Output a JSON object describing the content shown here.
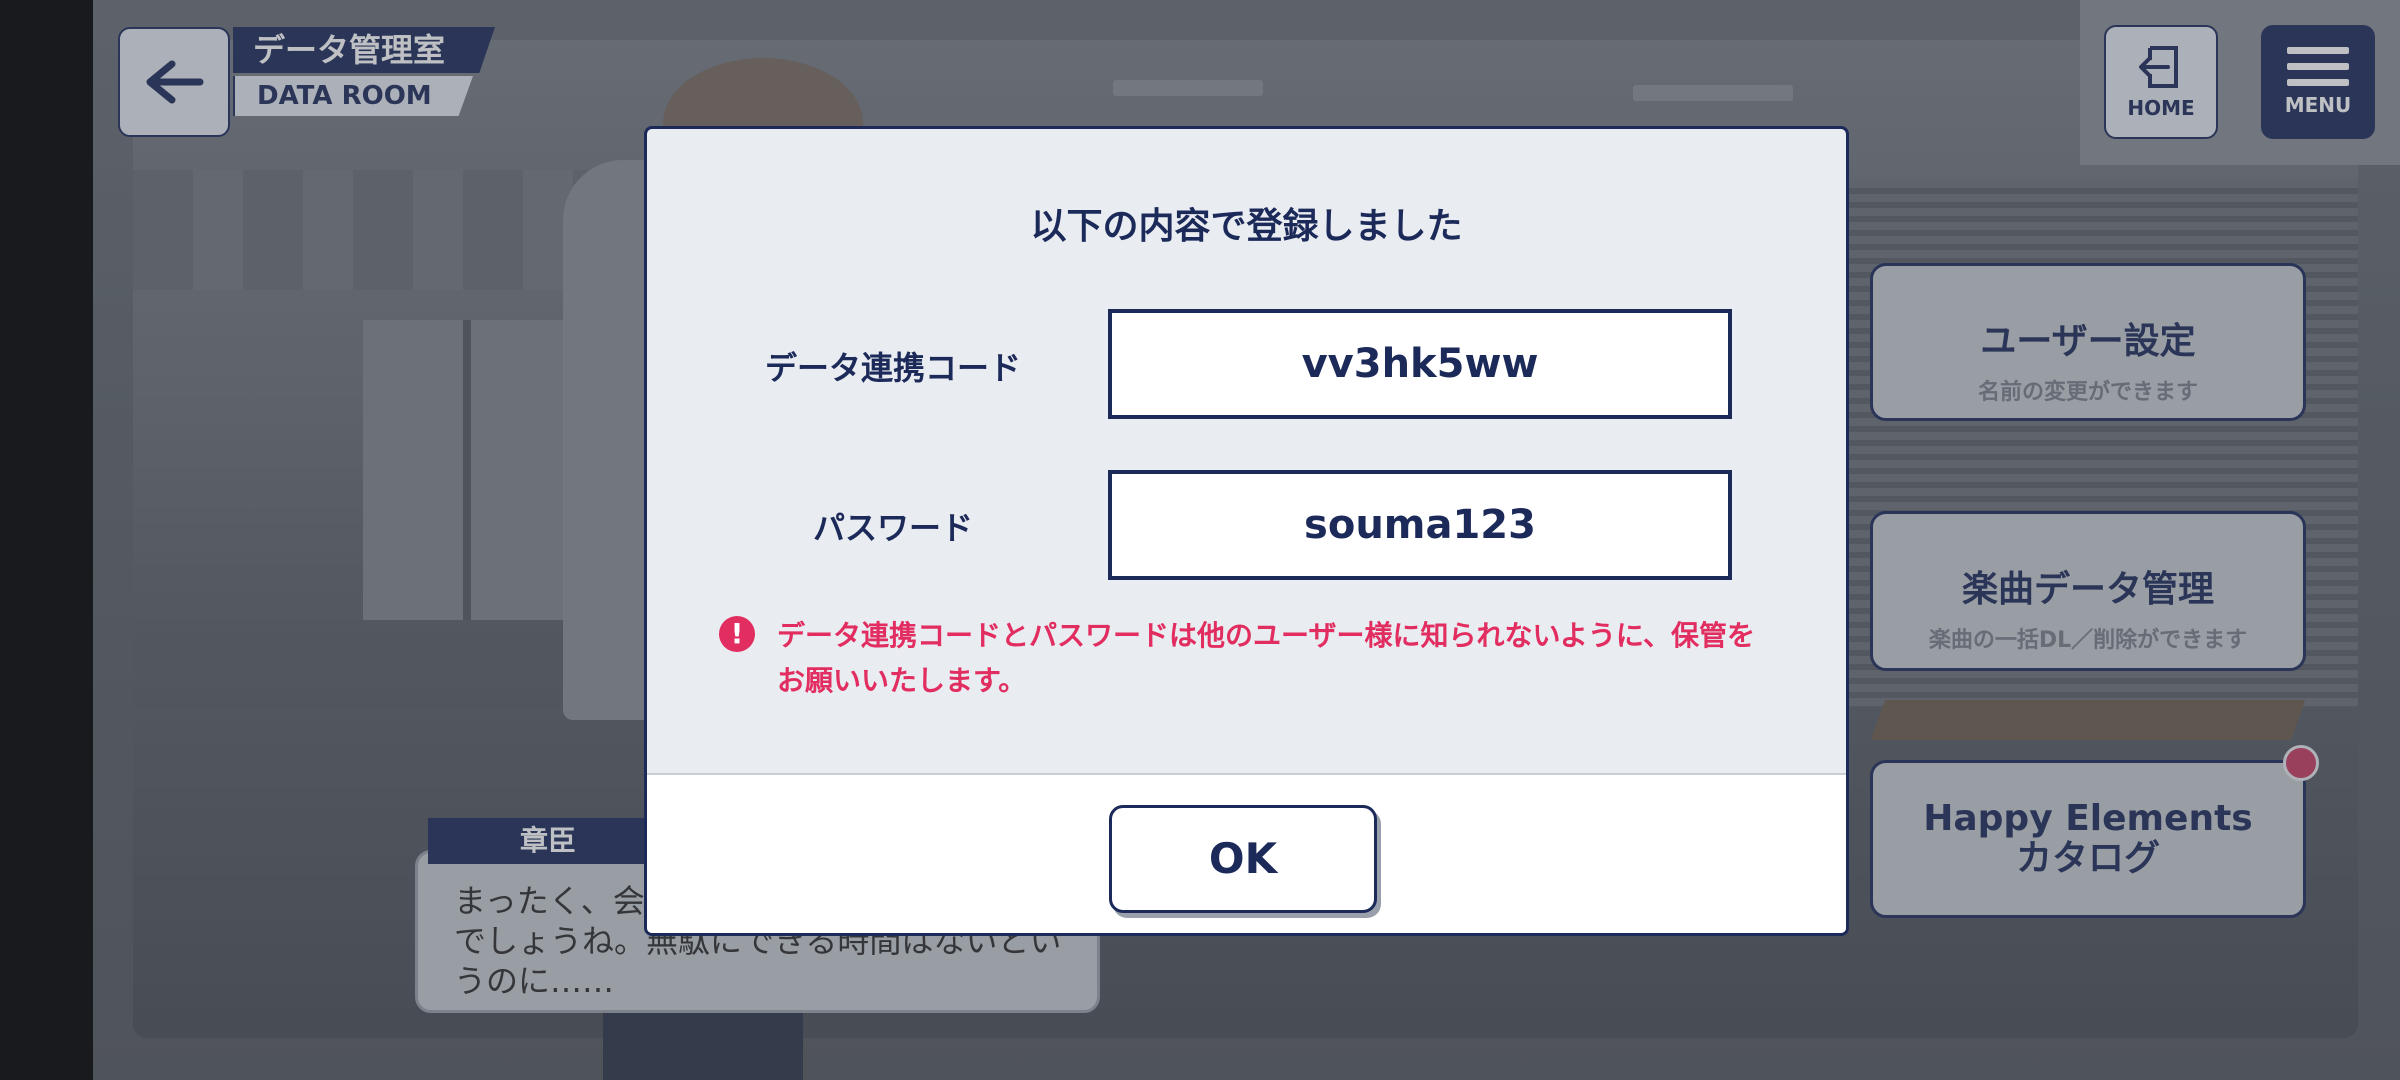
{
  "header": {
    "title_jp": "データ管理室",
    "title_en": "DATA ROOM",
    "back_icon": "arrow-left-icon"
  },
  "top_right": {
    "home_label": "HOME",
    "menu_label": "MENU"
  },
  "side_menu": [
    {
      "title": "ユーザー設定",
      "subtitle": "名前の変更ができます"
    },
    {
      "title": "楽曲データ管理",
      "subtitle": "楽曲の一括DL／削除ができます"
    },
    {
      "title_line1": "Happy Elements",
      "title_line2": "カタログ"
    }
  ],
  "dialogue": {
    "speaker": "章臣",
    "text_line1": "まったく、会",
    "text_line2": "でしょうね。無駄にできる時間はないとい",
    "text_line3": "うのに……"
  },
  "modal": {
    "title": "以下の内容で登録しました",
    "code_label": "データ連携コード",
    "code_value": "vv3hk5ww",
    "password_label": "パスワード",
    "password_value": "souma123",
    "warning_line1": "データ連携コードとパスワードは他のユーザー様に知られないように、保管を",
    "warning_line2": "お願いいたします。",
    "ok_label": "OK"
  },
  "colors": {
    "navy": "#1c2a5a",
    "warning": "#e22d61",
    "notification": "#c63b62"
  }
}
